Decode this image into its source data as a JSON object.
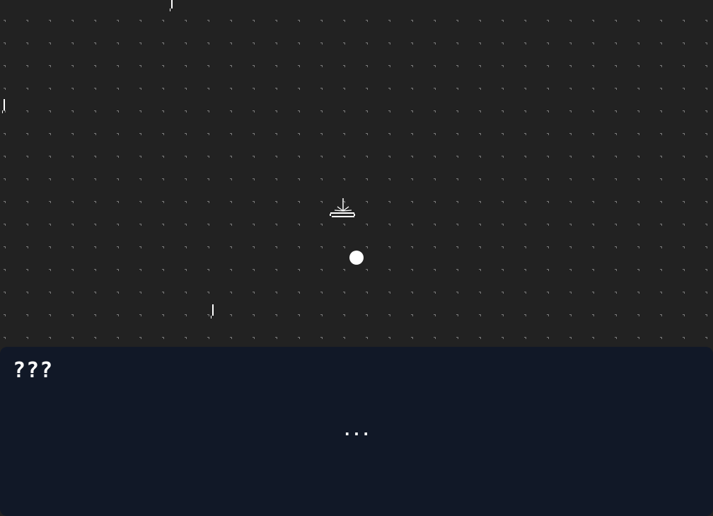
{
  "game": {
    "speaker_name": "???",
    "dialog_text": "..."
  },
  "colors": {
    "background": "#222222",
    "grid_dot": "#7a7a7a",
    "dialog_background": "#111827",
    "text": "#ffffff",
    "player": "#ffffff"
  },
  "icons": {
    "player": "white-circle",
    "campfire": "campfire-sprite",
    "rain": "rain-streak"
  }
}
